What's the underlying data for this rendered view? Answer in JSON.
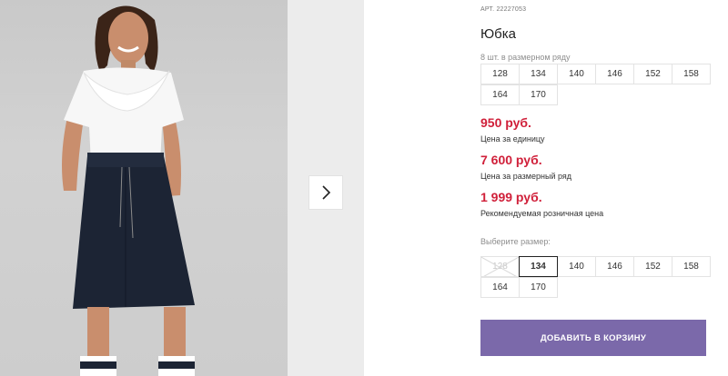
{
  "product": {
    "art_label": "АРТ.",
    "art_number": "22227053",
    "title": "Юбка"
  },
  "set_sizes": {
    "label": "8 шт. в размерном ряду",
    "items": [
      "128",
      "134",
      "140",
      "146",
      "152",
      "158",
      "164",
      "170"
    ]
  },
  "prices": {
    "unit_price": "950 руб.",
    "unit_caption": "Цена за единицу",
    "set_price": "7 600 руб.",
    "set_caption": "Цена за размерный ряд",
    "retail_price": "1 999 руб.",
    "retail_caption": "Рекомендуемая розничная цена"
  },
  "size_picker": {
    "label": "Выберите размер:",
    "selected": "134",
    "unavailable": [
      "128"
    ],
    "items": [
      "128",
      "134",
      "140",
      "146",
      "152",
      "158",
      "164",
      "170"
    ]
  },
  "cart": {
    "button_label": "ДОБАВИТЬ В КОРЗИНУ"
  },
  "gallery": {
    "next_icon": "chevron-right-icon"
  },
  "colors": {
    "price": "#d0203a",
    "button": "#7b69aa"
  }
}
